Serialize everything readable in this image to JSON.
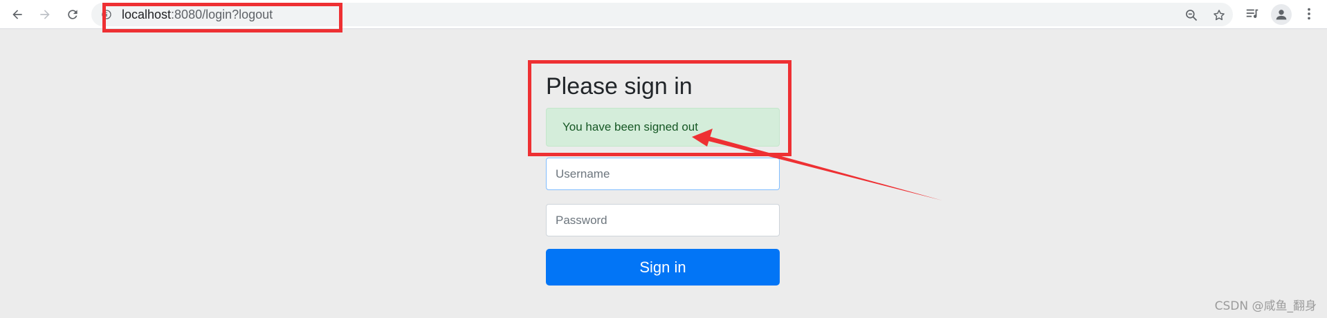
{
  "browser": {
    "url_host": "localhost",
    "url_rest": ":8080/login?logout",
    "icons": {
      "back": "arrow-left-icon",
      "forward": "arrow-right-icon",
      "reload": "reload-icon",
      "site_info": "info-circle-icon",
      "zoom": "zoom-out-icon",
      "bookmark": "star-icon",
      "reading_list": "reading-list-icon",
      "profile": "user-avatar-icon",
      "menu": "more-vert-icon"
    }
  },
  "signin": {
    "title": "Please sign in",
    "alert": "You have been signed out",
    "username_placeholder": "Username",
    "password_placeholder": "Password",
    "submit_label": "Sign in"
  },
  "watermark": "CSDN @咸鱼_翻身",
  "colors": {
    "primary": "#0275f6",
    "alert_bg": "#d4edda",
    "alert_text": "#155724",
    "annotation": "#ee3033"
  }
}
